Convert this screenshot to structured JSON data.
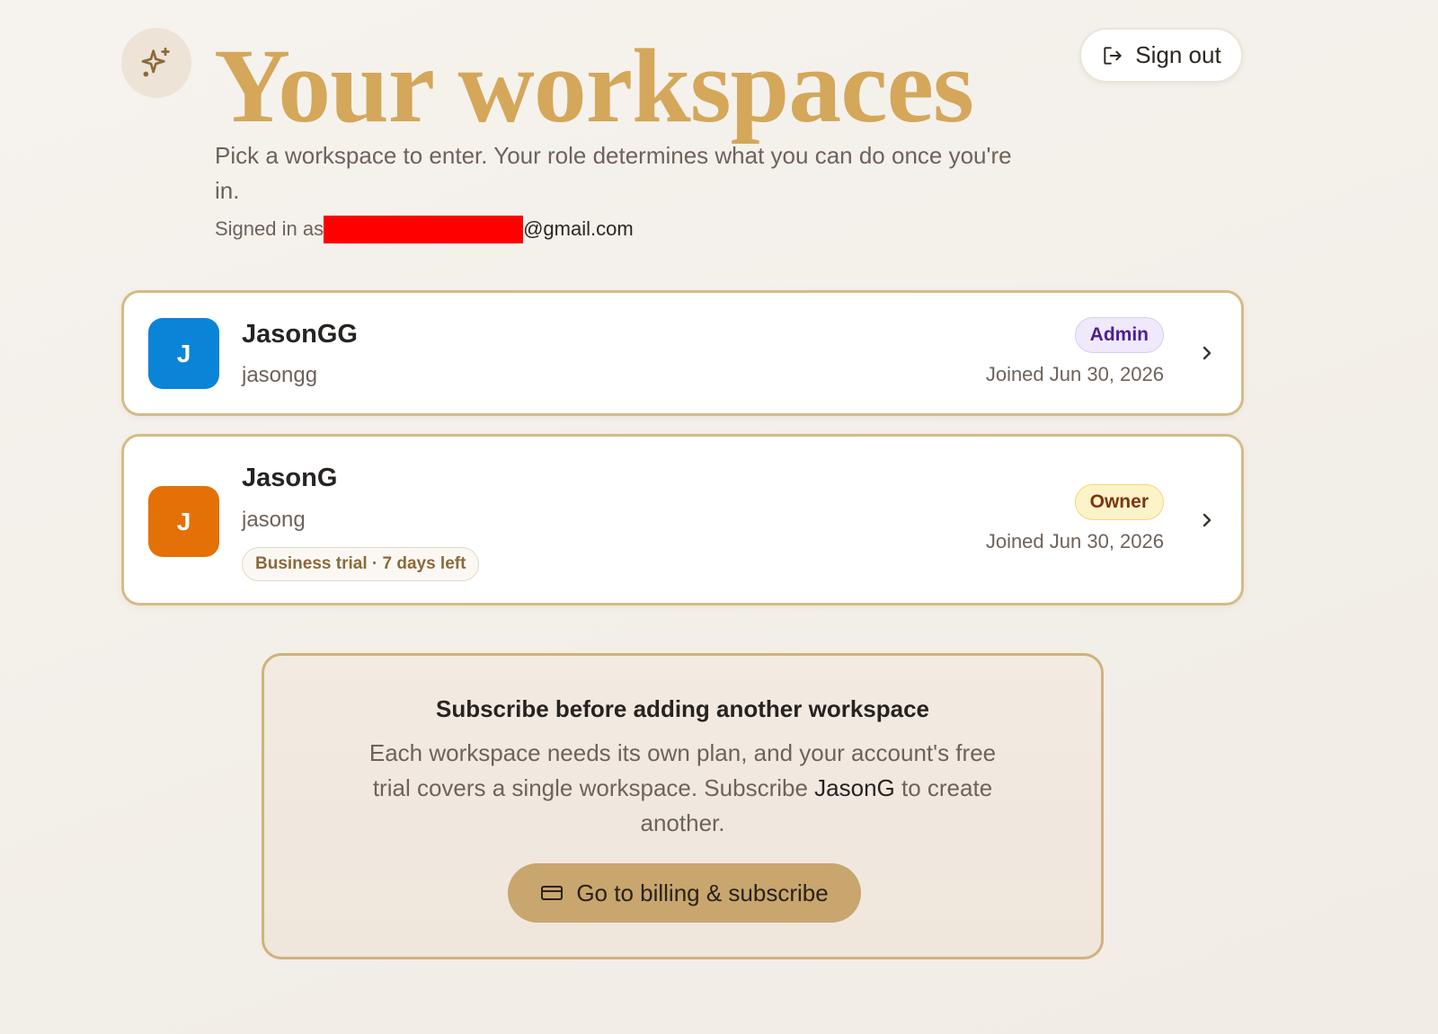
{
  "header": {
    "title": "Your workspaces",
    "subtitle": "Pick a workspace to enter. Your role determines what you can do once you're in.",
    "signed_in_label": "Signed in as",
    "email_suffix": "@gmail.com",
    "sign_out_label": "Sign out"
  },
  "workspaces": [
    {
      "initial": "J",
      "name": "JasonGG",
      "slug": "jasongg",
      "role": "Admin",
      "joined": "Joined Jun 30, 2026",
      "avatar_color": "#0a84d6"
    },
    {
      "initial": "J",
      "name": "JasonG",
      "slug": "jasong",
      "trial_badge": "Business trial · 7 days left",
      "role": "Owner",
      "joined": "Joined Jun 30, 2026",
      "avatar_color": "#e37107"
    }
  ],
  "subscribe": {
    "title": "Subscribe before adding another workspace",
    "body_before": "Each workspace needs its own plan, and your account's free trial covers a single workspace. Subscribe ",
    "body_workspace": "JasonG",
    "body_after": " to create another.",
    "button_label": "Go to billing & subscribe"
  },
  "colors": {
    "accent_gold": "#d4a75a",
    "card_border": "#d6bb86",
    "button_gold": "#c8a66d"
  },
  "icons": {
    "logo": "sparkles-icon",
    "sign_out": "sign-out-icon",
    "chevron": "chevron-right-icon",
    "billing": "credit-card-icon"
  }
}
